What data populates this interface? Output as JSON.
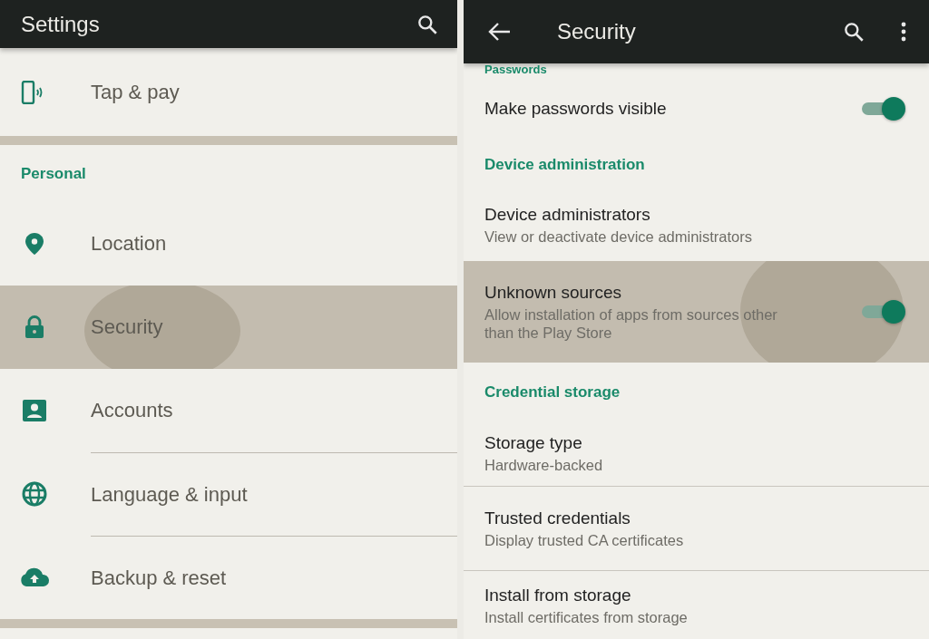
{
  "left": {
    "title": "Settings",
    "groups": [
      {
        "items": [
          {
            "label": "Tap & pay",
            "selected": false
          }
        ]
      },
      {
        "header": "Personal",
        "items": [
          {
            "label": "Location",
            "selected": false
          },
          {
            "label": "Security",
            "selected": true
          },
          {
            "label": "Accounts",
            "selected": false
          },
          {
            "label": "Language & input",
            "selected": false
          },
          {
            "label": "Backup & reset",
            "selected": false
          }
        ]
      }
    ]
  },
  "right": {
    "title": "Security",
    "sections": [
      {
        "header": "Passwords",
        "items": [
          {
            "kind": "switch",
            "title": "Make passwords visible",
            "on": true,
            "selected": false
          }
        ]
      },
      {
        "header": "Device administration",
        "items": [
          {
            "kind": "link",
            "title": "Device administrators",
            "summary": "View or deactivate device administrators",
            "selected": false
          },
          {
            "kind": "switch",
            "title": "Unknown sources",
            "summary": "Allow installation of apps from sources other than the Play Store",
            "on": true,
            "selected": true
          }
        ]
      },
      {
        "header": "Credential storage",
        "items": [
          {
            "kind": "link",
            "title": "Storage type",
            "summary": "Hardware-backed",
            "selected": false
          },
          {
            "kind": "link",
            "title": "Trusted credentials",
            "summary": "Display trusted CA certificates",
            "selected": false
          },
          {
            "kind": "link",
            "title": "Install from storage",
            "summary": "Install certificates from storage",
            "selected": false
          }
        ]
      }
    ]
  }
}
